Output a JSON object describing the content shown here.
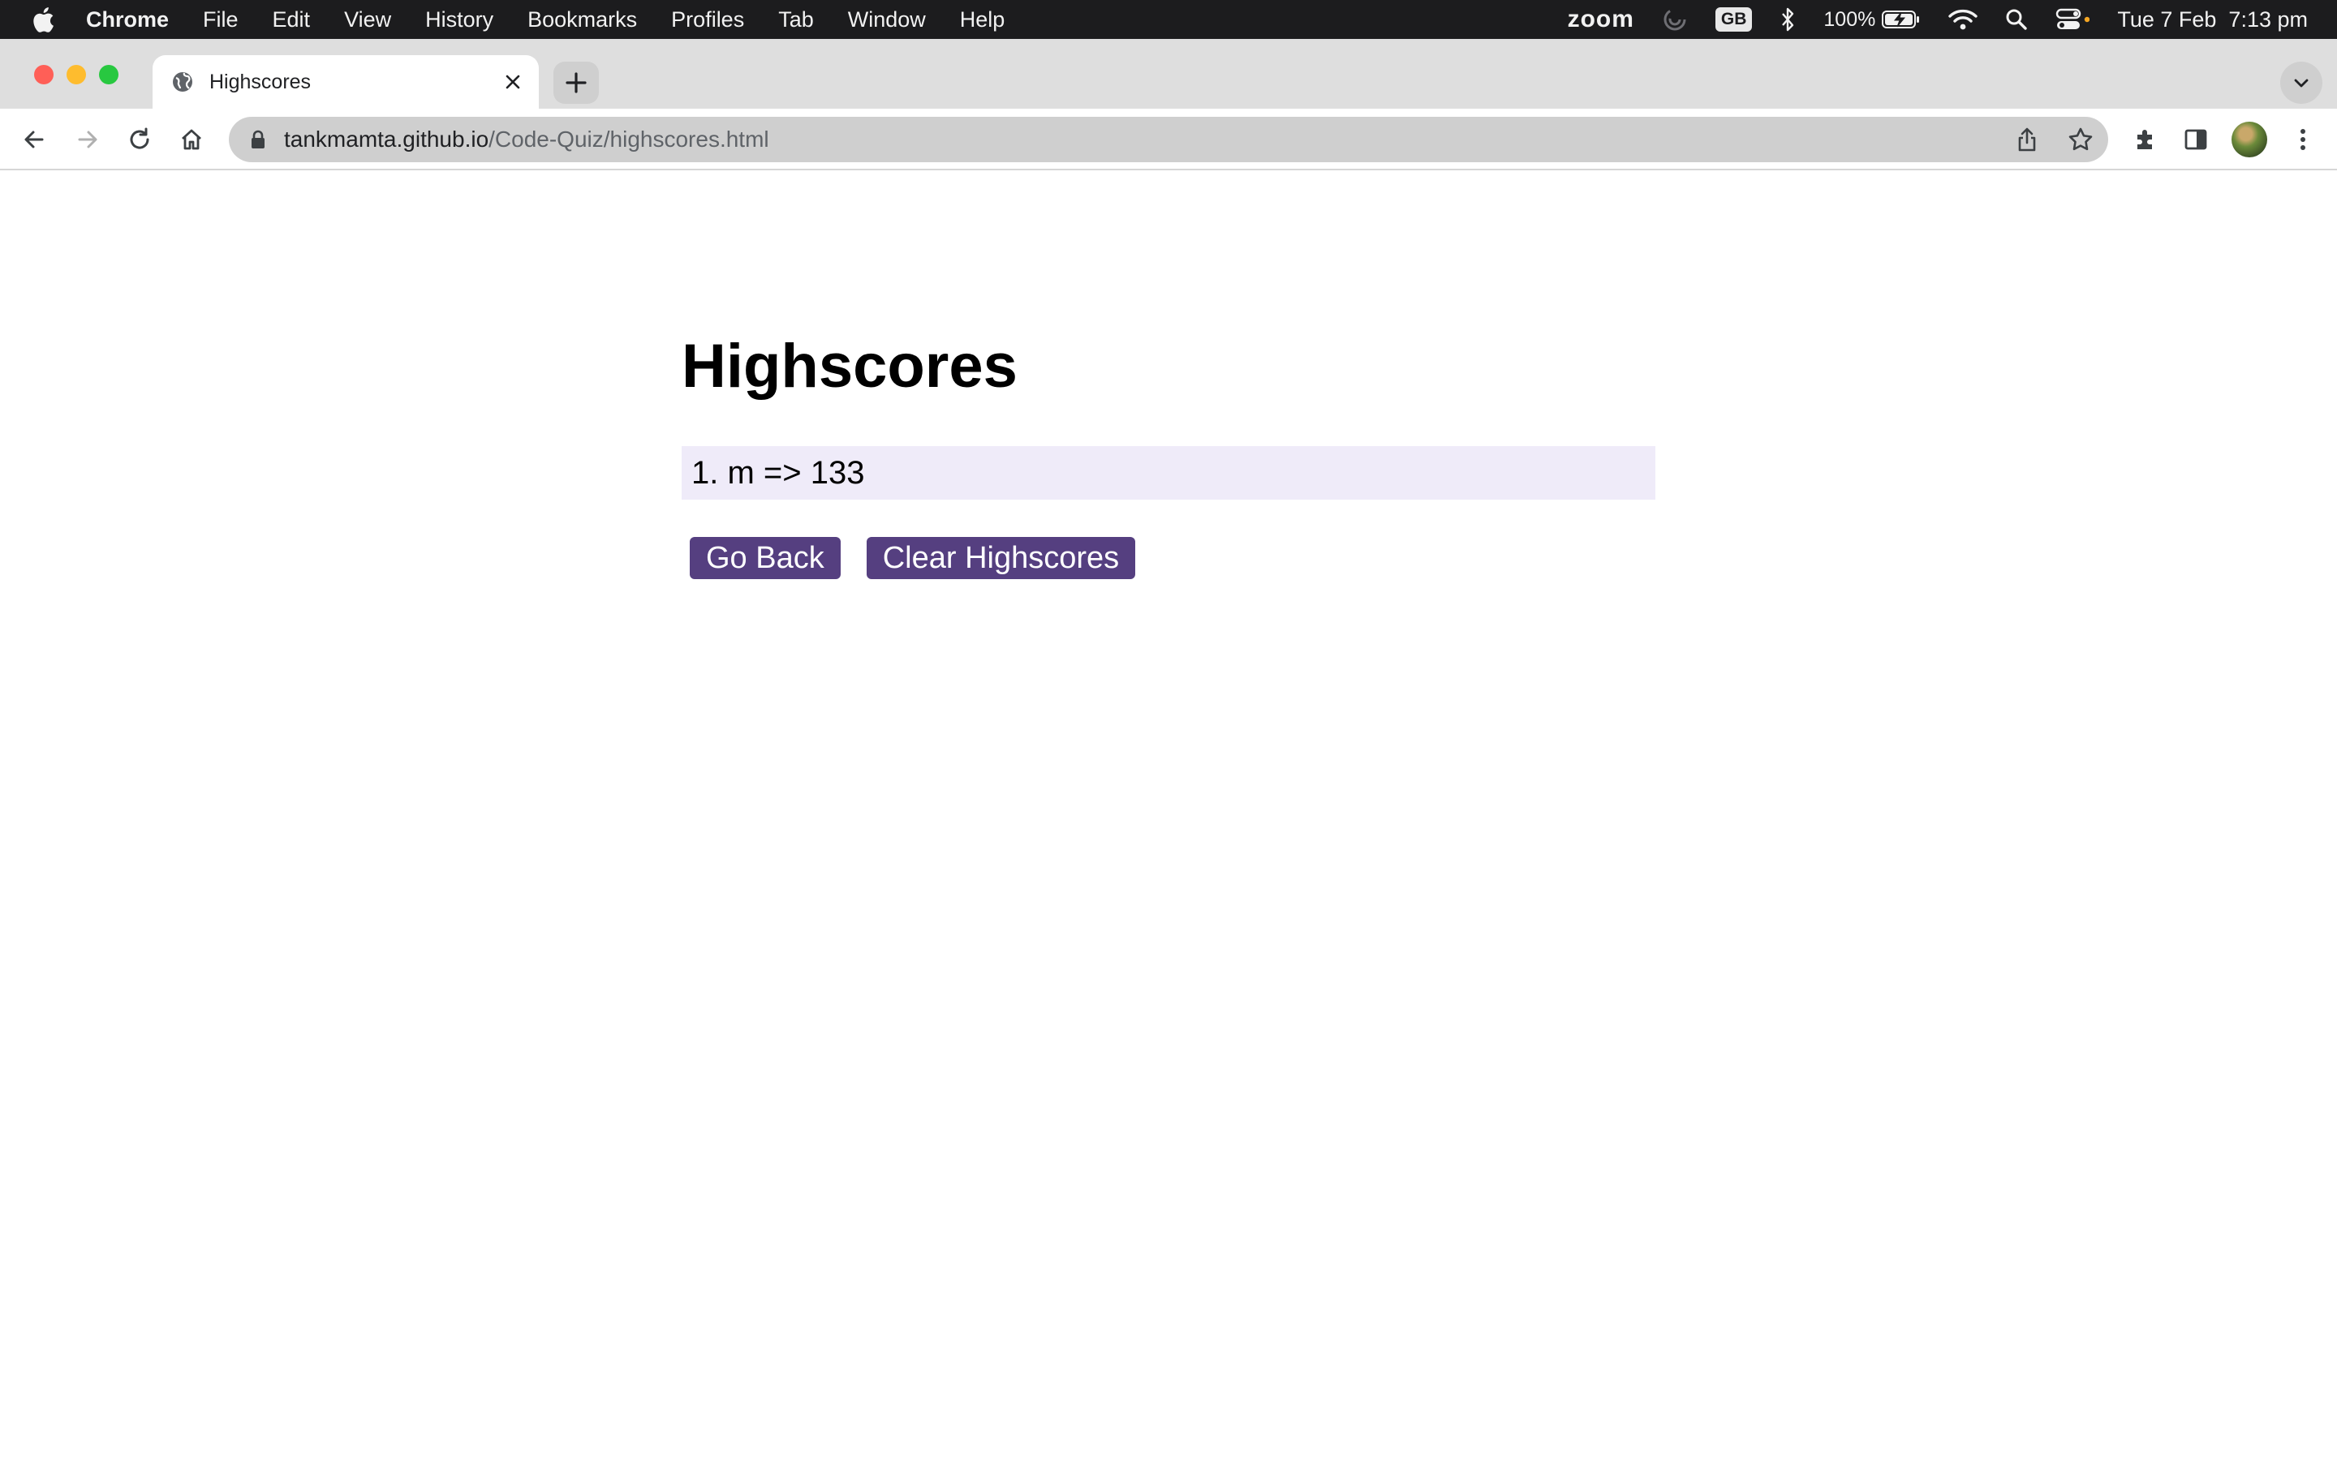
{
  "menubar": {
    "app_name": "Chrome",
    "items": [
      "File",
      "Edit",
      "View",
      "History",
      "Bookmarks",
      "Profiles",
      "Tab",
      "Window",
      "Help"
    ],
    "status": {
      "zoom": "zoom",
      "input_source": "GB",
      "battery": "100%",
      "datetime": "Tue 7 Feb  7:13 pm"
    },
    "icons": [
      "apple-icon",
      "activity-icon",
      "bluetooth-icon",
      "battery-charging-icon",
      "wifi-icon",
      "spotlight-icon",
      "control-center-icon"
    ]
  },
  "browser": {
    "tab": {
      "title": "Highscores",
      "favicon": "globe-icon"
    },
    "url": {
      "host": "tankmamta.github.io",
      "path": "/Code-Quiz/highscores.html"
    },
    "traffic_colors": {
      "close": "#ff5f57",
      "minimize": "#febc2e",
      "maximize": "#28c840"
    }
  },
  "page": {
    "title": "Highscores",
    "scores": [
      "1. m => 133"
    ],
    "buttons": {
      "go_back": "Go Back",
      "clear": "Clear Highscores"
    },
    "colors": {
      "button_bg": "#553f80",
      "score_bg": "#efebf9"
    }
  }
}
